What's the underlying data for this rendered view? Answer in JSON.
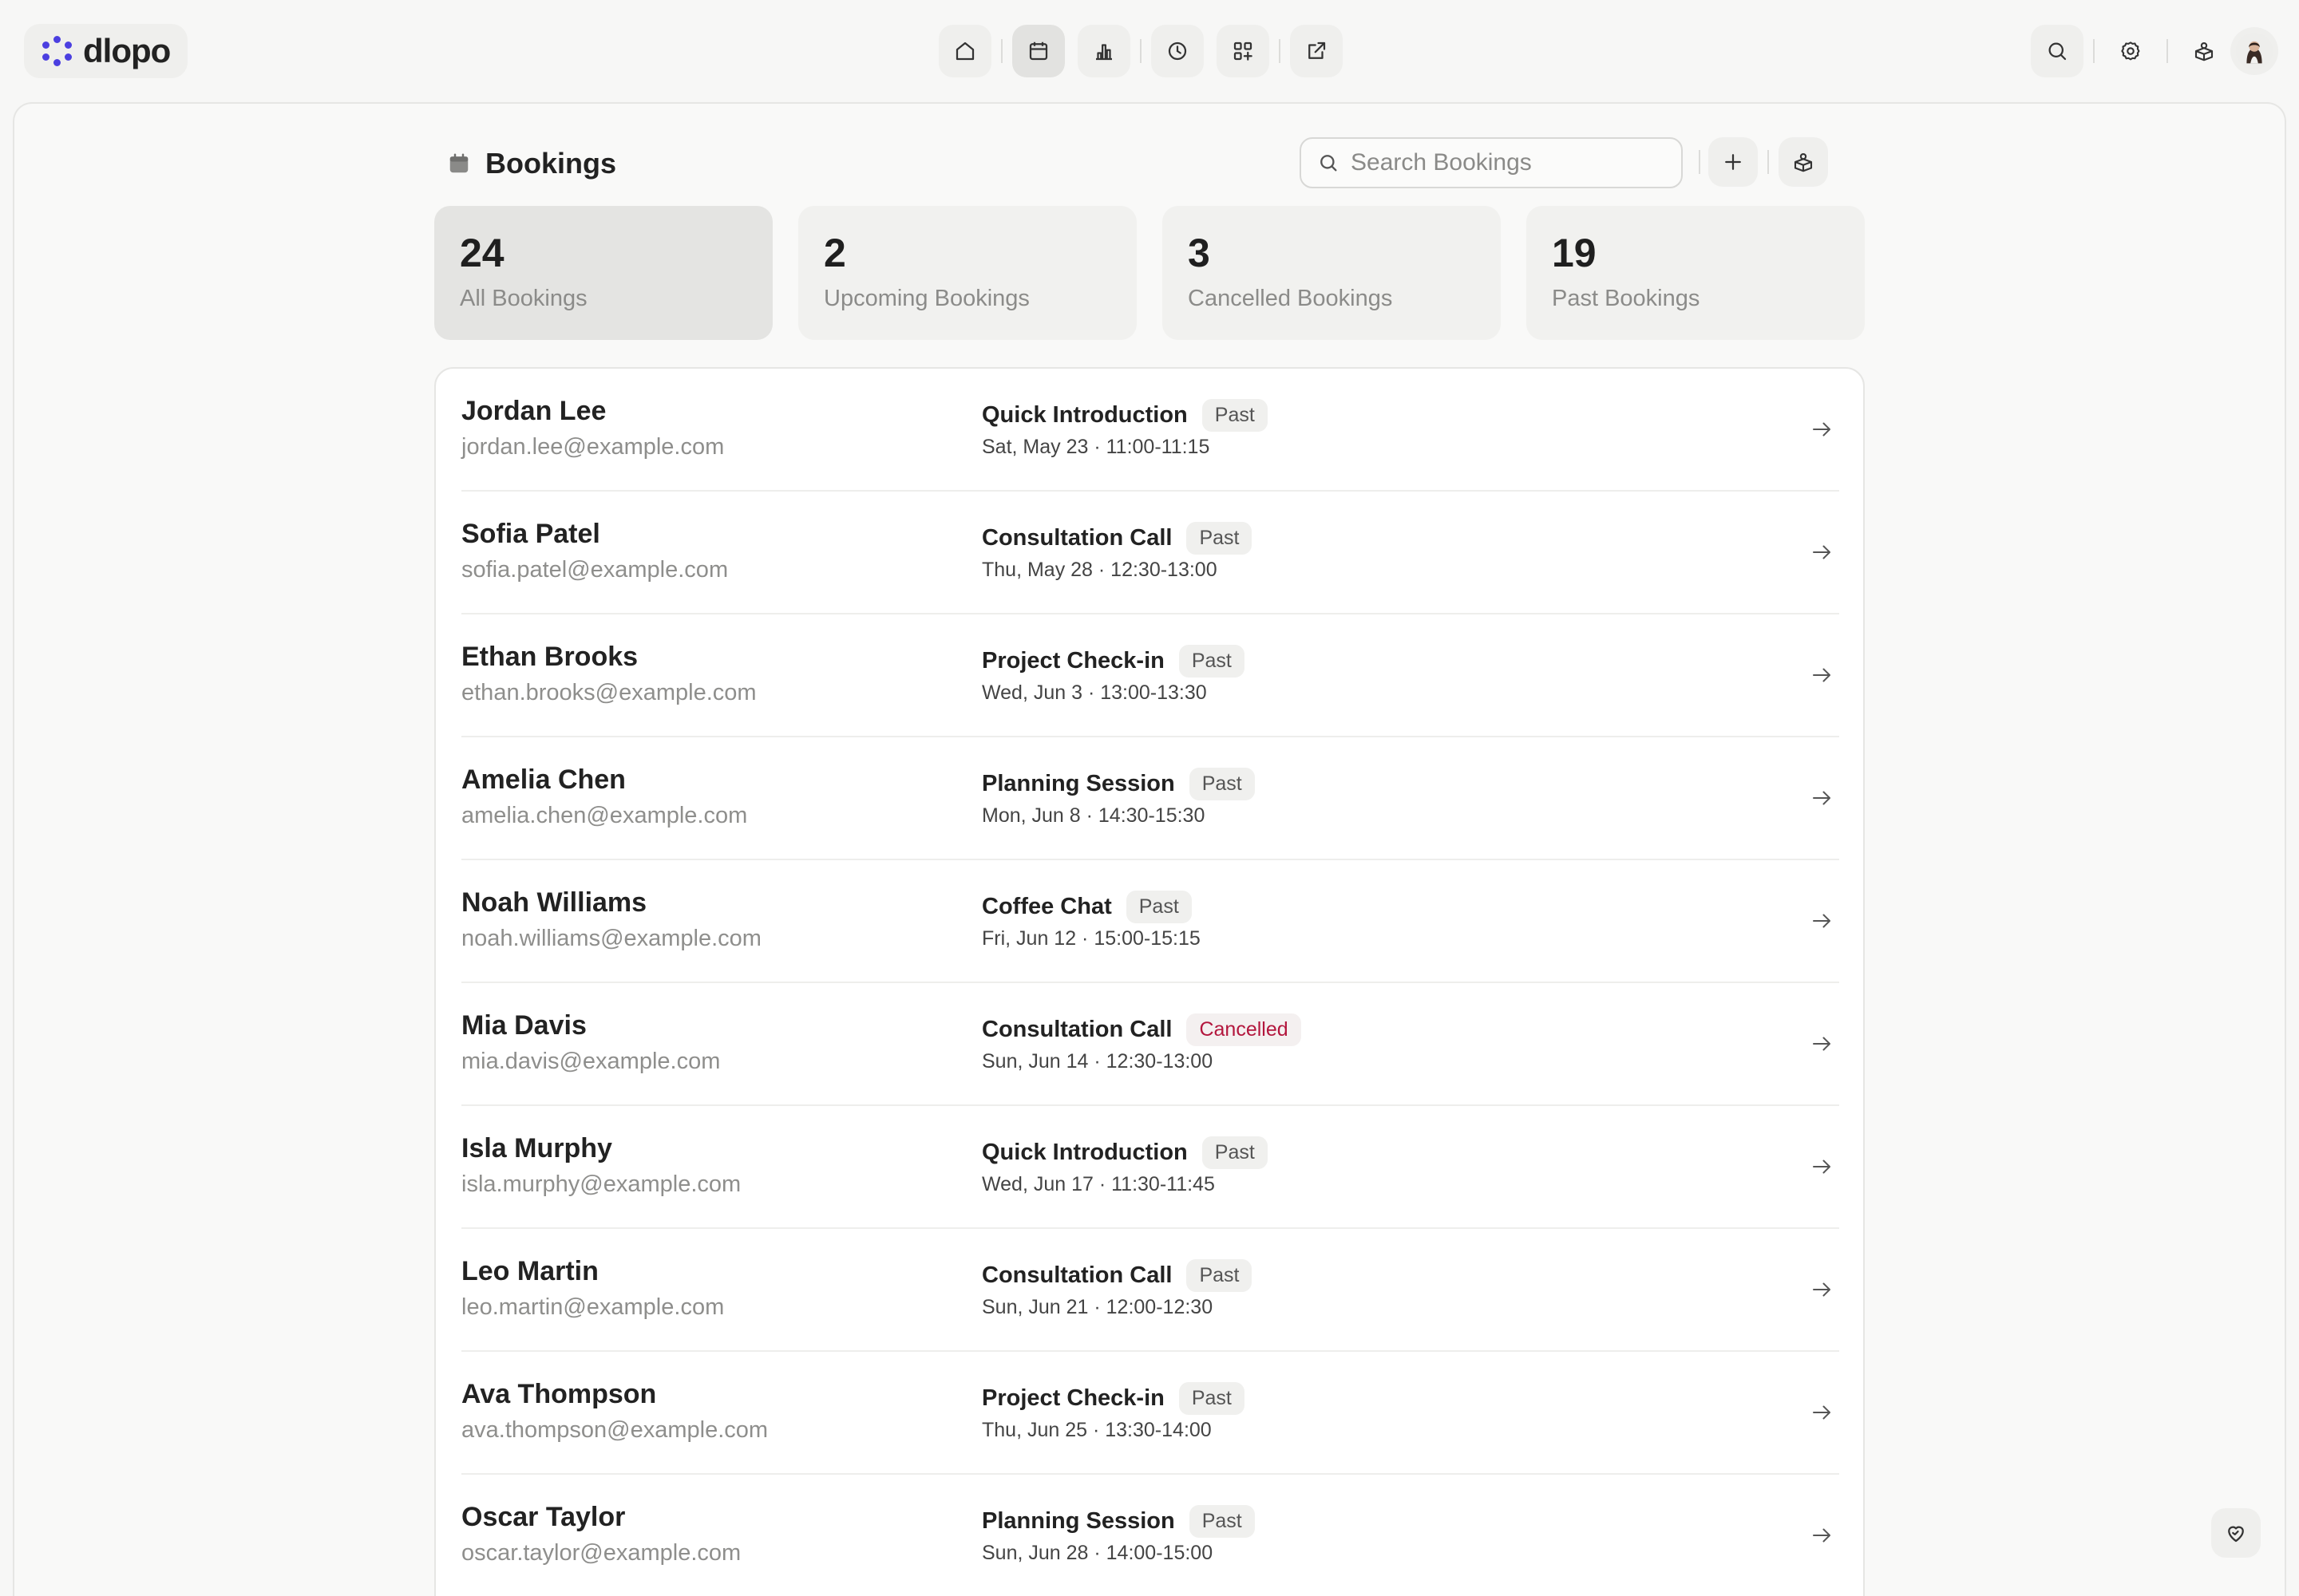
{
  "brand": {
    "name": "dlopo",
    "accent": "#4b3fe0"
  },
  "nav": {
    "center": [
      {
        "key": "home",
        "icon": "home-icon"
      },
      {
        "key": "bookings",
        "icon": "calendar-icon",
        "active": true
      },
      {
        "key": "analytics",
        "icon": "bar-chart-icon"
      },
      {
        "key": "history",
        "icon": "clock-icon"
      },
      {
        "key": "apps",
        "icon": "apps-plus-icon"
      },
      {
        "key": "share",
        "icon": "external-link-icon"
      }
    ],
    "right": [
      {
        "key": "search",
        "icon": "search-icon"
      },
      {
        "key": "settings",
        "icon": "gear-icon"
      },
      {
        "key": "integrations",
        "icon": "box-person-icon"
      },
      {
        "key": "profile",
        "icon": "avatar-icon"
      }
    ]
  },
  "page": {
    "title": "Bookings",
    "search_placeholder": "Search Bookings"
  },
  "stats": [
    {
      "value": "24",
      "label": "All Bookings",
      "active": true
    },
    {
      "value": "2",
      "label": "Upcoming Bookings"
    },
    {
      "value": "3",
      "label": "Cancelled Bookings"
    },
    {
      "value": "19",
      "label": "Past Bookings"
    }
  ],
  "bookings": [
    {
      "name": "Jordan Lee",
      "email": "jordan.lee@example.com",
      "event": "Quick Introduction",
      "status": "Past",
      "when": "Sat, May 23 · 11:00-11:15"
    },
    {
      "name": "Sofia Patel",
      "email": "sofia.patel@example.com",
      "event": "Consultation Call",
      "status": "Past",
      "when": "Thu, May 28 · 12:30-13:00"
    },
    {
      "name": "Ethan Brooks",
      "email": "ethan.brooks@example.com",
      "event": "Project Check-in",
      "status": "Past",
      "when": "Wed, Jun 3 · 13:00-13:30"
    },
    {
      "name": "Amelia Chen",
      "email": "amelia.chen@example.com",
      "event": "Planning Session",
      "status": "Past",
      "when": "Mon, Jun 8 · 14:30-15:30"
    },
    {
      "name": "Noah Williams",
      "email": "noah.williams@example.com",
      "event": "Coffee Chat",
      "status": "Past",
      "when": "Fri, Jun 12 · 15:00-15:15"
    },
    {
      "name": "Mia Davis",
      "email": "mia.davis@example.com",
      "event": "Consultation Call",
      "status": "Cancelled",
      "when": "Sun, Jun 14 · 12:30-13:00"
    },
    {
      "name": "Isla Murphy",
      "email": "isla.murphy@example.com",
      "event": "Quick Introduction",
      "status": "Past",
      "when": "Wed, Jun 17 · 11:30-11:45"
    },
    {
      "name": "Leo Martin",
      "email": "leo.martin@example.com",
      "event": "Consultation Call",
      "status": "Past",
      "when": "Sun, Jun 21 · 12:00-12:30"
    },
    {
      "name": "Ava Thompson",
      "email": "ava.thompson@example.com",
      "event": "Project Check-in",
      "status": "Past",
      "when": "Thu, Jun 25 · 13:30-14:00"
    },
    {
      "name": "Oscar Taylor",
      "email": "oscar.taylor@example.com",
      "event": "Planning Session",
      "status": "Past",
      "when": "Sun, Jun 28 · 14:00-15:00"
    }
  ],
  "colors": {
    "cancelled": "#b3163d",
    "muted": "#8e8e8c"
  }
}
